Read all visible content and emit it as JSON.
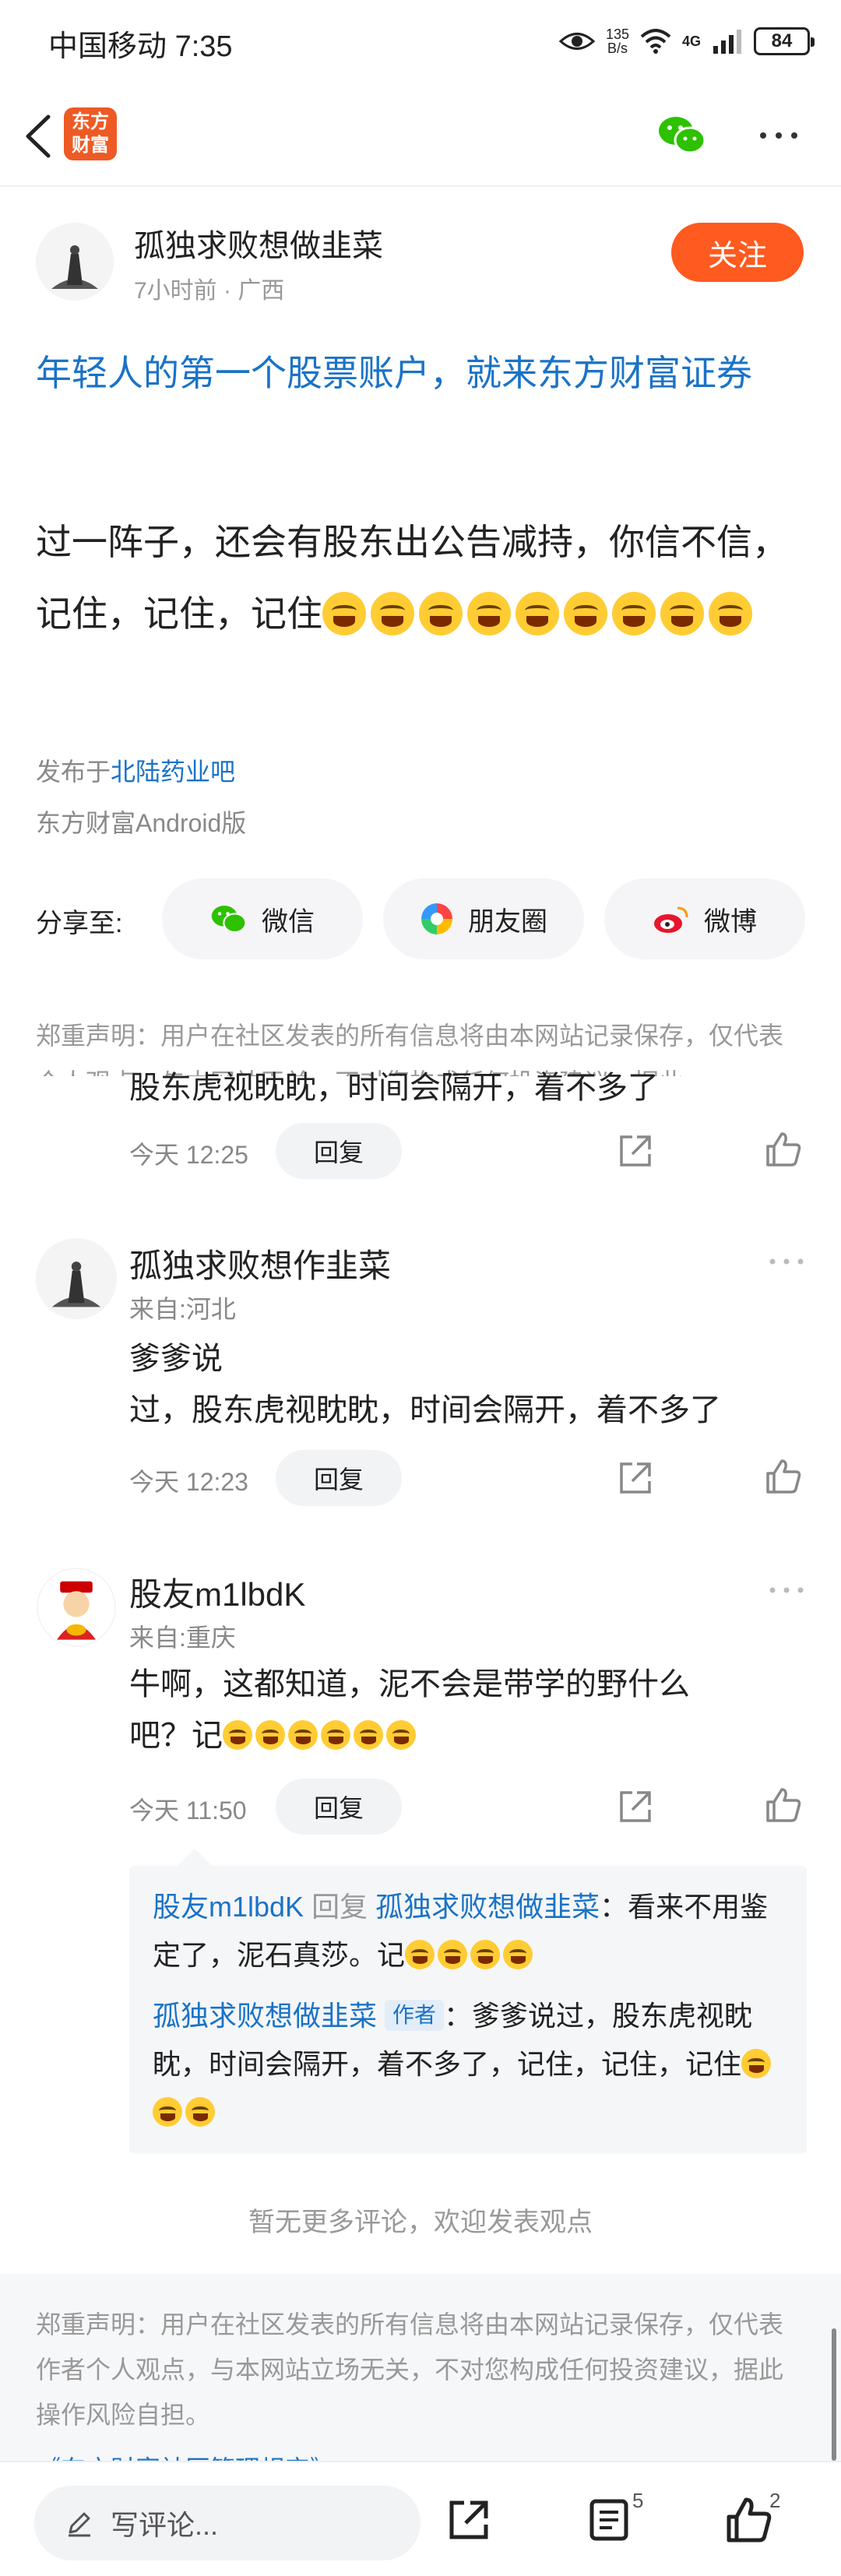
{
  "status_bar": {
    "carrier": "中国移动",
    "time": "7:35",
    "net_speed": "135",
    "net_unit": "B/s",
    "network": "4G",
    "battery": "84"
  },
  "nav": {
    "logo_line1": "东方",
    "logo_line2": "财富"
  },
  "post": {
    "author": "孤独求败想做韭菜",
    "time": "7小时前",
    "location": "广西",
    "follow_label": "关注",
    "title": "年轻人的第一个股票账户，就来东方财富证券",
    "body_text": "过一阵子，还会有股东出公告减持，你信不信，记住，记住，记住",
    "origin_prefix": "发布于",
    "origin_bar": "北陆药业吧",
    "client": "东方财富Android版"
  },
  "share": {
    "label": "分享至:",
    "buttons": [
      "微信",
      "朋友圈",
      "微博"
    ]
  },
  "notice_top": "郑重声明：用户在社区发表的所有信息将由本网站记录保存，仅代表个人观点，与本网站无关，不对您构成任何投资建议，据此",
  "comments": [
    {
      "text": "股东虎视眈眈，时间会隔开，着不多了",
      "time": "今天 12:25",
      "reply_label": "回复"
    },
    {
      "name": "孤独求败想作韭菜",
      "location": "来自:河北",
      "text_line1": "爹爹说",
      "text_line2": "过，股东虎视眈眈，时间会隔开，着不多了",
      "time": "今天 12:23",
      "reply_label": "回复"
    },
    {
      "name": "股友m1lbdK",
      "location": "来自:重庆",
      "text_line1": "牛啊，这都知道，泥不会是带学的野什么",
      "text_line2": "吧？记",
      "time": "今天 11:50",
      "reply_label": "回复",
      "replies": [
        {
          "user": "股友m1lbdK",
          "action": "回复",
          "target": "孤独求败想做韭菜",
          "text": "：看来不用鉴定了，泥石真莎。记"
        },
        {
          "user": "孤独求败想做韭菜",
          "tag": "作者",
          "text": "：爹爹说过，股东虎视眈眈，时间会隔开，着不多了，记住，记住，记住"
        }
      ]
    }
  ],
  "no_more": "暂无更多评论，欢迎发表观点",
  "notice_bottom": {
    "text": "郑重声明：用户在社区发表的所有信息将由本网站记录保存，仅代表作者个人观点，与本网站立场无关，不对您构成任何投资建议，据此操作风险自担。",
    "rule_link": "《东方财富社区管理规定》"
  },
  "bottom_bar": {
    "comment_placeholder": "写评论...",
    "comment_count": "5",
    "like_count": "2"
  },
  "colors": {
    "accent": "#ff5a1f",
    "link": "#1a73c7",
    "muted": "#999999"
  }
}
